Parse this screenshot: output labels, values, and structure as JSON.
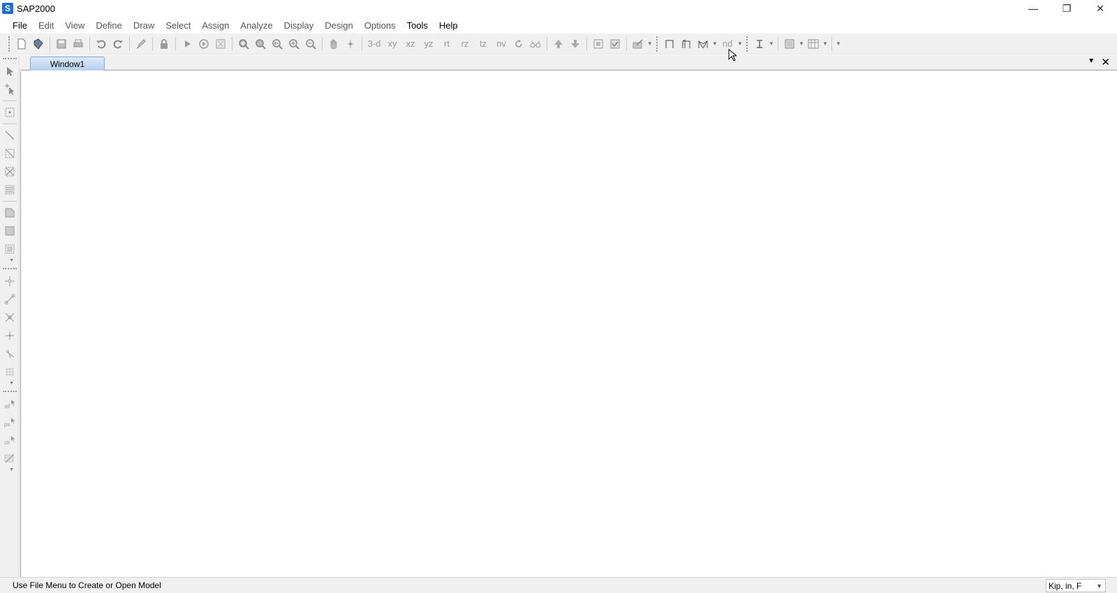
{
  "window": {
    "title": "SAP2000",
    "app_icon_letter": "S",
    "controls": {
      "minimize": "—",
      "restore": "❐",
      "close": "✕"
    }
  },
  "menu": [
    {
      "label": "File",
      "strong": true
    },
    {
      "label": "Edit",
      "strong": false
    },
    {
      "label": "View",
      "strong": false
    },
    {
      "label": "Define",
      "strong": false
    },
    {
      "label": "Draw",
      "strong": false
    },
    {
      "label": "Select",
      "strong": false
    },
    {
      "label": "Assign",
      "strong": false
    },
    {
      "label": "Analyze",
      "strong": false
    },
    {
      "label": "Display",
      "strong": false
    },
    {
      "label": "Design",
      "strong": false
    },
    {
      "label": "Options",
      "strong": false
    },
    {
      "label": "Tools",
      "strong": true
    },
    {
      "label": "Help",
      "strong": true
    }
  ],
  "toolbar": {
    "view_labels": {
      "three_d": "3-d",
      "xy": "xy",
      "xz": "xz",
      "yz": "yz",
      "rt": "rt",
      "rz": "rz",
      "tz": "tz",
      "nv": "nv",
      "nd": "nd"
    }
  },
  "tabs": [
    {
      "label": "Window1",
      "active": true
    }
  ],
  "status": {
    "message": "Use File Menu to Create or Open Model",
    "units": "Kip, in, F"
  },
  "colors": {
    "accent": "#1f6fd1",
    "tab_active": "#b7cff0",
    "chrome": "#f0f0f0"
  }
}
